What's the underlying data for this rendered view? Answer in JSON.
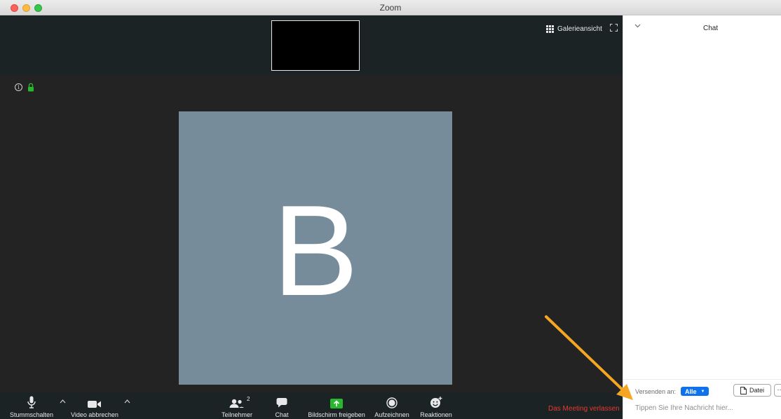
{
  "window": {
    "title": "Zoom"
  },
  "video": {
    "gallery_view_label": "Galerieansicht",
    "avatar_letter": "B",
    "avatar_color": "#768c9a"
  },
  "toolbar": {
    "mute_label": "Stummschalten",
    "video_label": "Video abbrechen",
    "participants_label": "Teilnehmer",
    "participants_count": "2",
    "chat_label": "Chat",
    "share_label": "Bildschirm freigeben",
    "record_label": "Aufzeichnen",
    "reactions_label": "Reaktionen",
    "leave_label": "Das Meeting verlassen",
    "share_accent": "#26b82e",
    "leave_color": "#e8382f"
  },
  "chat": {
    "title": "Chat",
    "send_to_label": "Versenden an:",
    "recipient": "Alle",
    "file_button": "Datei",
    "more_button": "···",
    "input_placeholder": "Tippen Sie Ihre Nachricht hier...",
    "recipient_color": "#0e72ed"
  },
  "annotation": {
    "arrow_color": "#f5a623"
  }
}
